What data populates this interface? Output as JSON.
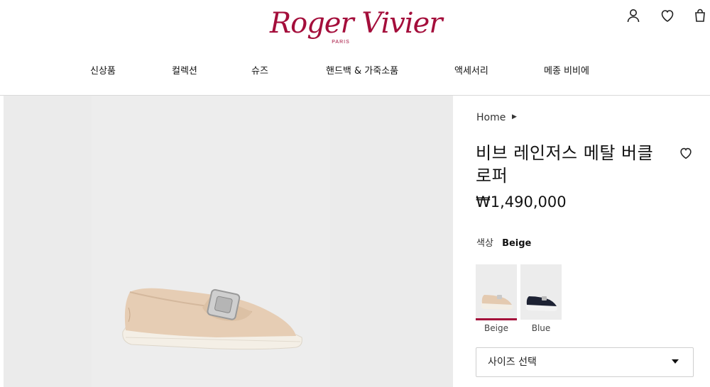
{
  "brand": {
    "name": "Roger Vivier",
    "sub": "PARIS",
    "accent": "#a40e3b"
  },
  "header_icons": [
    "account-icon",
    "wishlist-heart-icon",
    "shopping-bag-icon"
  ],
  "nav": {
    "items": [
      {
        "label": "신상품"
      },
      {
        "label": "컬렉션"
      },
      {
        "label": "슈즈"
      },
      {
        "label": "핸드백 & 가죽소품"
      },
      {
        "label": "액세서리"
      },
      {
        "label": "메종 비비에"
      }
    ]
  },
  "breadcrumb": {
    "home": "Home"
  },
  "product": {
    "title": "비브 레인저스 메탈 버클 로퍼",
    "price": "₩1,490,000",
    "color_label": "색상",
    "color_value": "Beige",
    "swatches": [
      {
        "label": "Beige",
        "selected": true
      },
      {
        "label": "Blue",
        "selected": false
      }
    ],
    "size_label": "사이즈 선택"
  }
}
